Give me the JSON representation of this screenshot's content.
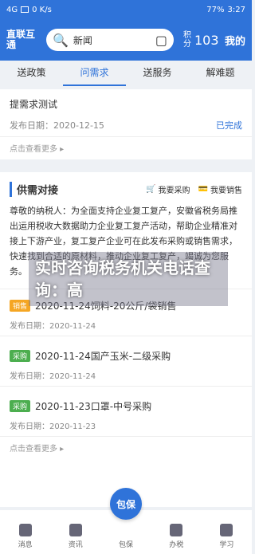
{
  "status": {
    "signal": "4G",
    "speed": "0 K/s",
    "battery": "77%",
    "time": "3:27"
  },
  "header": {
    "logo": "直联互通",
    "search_placeholder": "新闻",
    "score_label": "积分",
    "score": "103",
    "mine": "我的"
  },
  "tabs": [
    "送政策",
    "问需求",
    "送服务",
    "解难题"
  ],
  "demand": {
    "title": "提需求测试",
    "date_label": "发布日期：2020-12-15",
    "state": "已完成",
    "more": "点击查看更多 ▸"
  },
  "supply": {
    "title": "供需对接",
    "buy": "我要采购",
    "sell": "我要销售",
    "para": "尊敬的纳税人：为全面支持企业复工复产，安徽省税务局推出运用税收大数据助力企业复工复产活动，帮助企业精准对接上下游产业，复工复产企业可在此发布采购或销售需求，快速找到合适的原材料，推动企业复工复产，竭诚为您服务。",
    "items": [
      {
        "tag": "销售",
        "kind": "sell",
        "title": "2020-11-24饲料-20公斤/袋销售",
        "date": "发布日期：2020-11-24"
      },
      {
        "tag": "采购",
        "kind": "buy",
        "title": "2020-11-24国产玉米-二级采购",
        "date": "发布日期：2020-11-24"
      },
      {
        "tag": "采购",
        "kind": "buy",
        "title": "2020-11-23口罩-中号采购",
        "date": "发布日期：2020-11-23"
      }
    ],
    "more": "点击查看更多 ▸"
  },
  "overlay": "实时咨询税务机关电话查询：高",
  "nav": {
    "items": [
      "消息",
      "资讯",
      "包保",
      "办税",
      "学习"
    ],
    "fab": "包保"
  }
}
